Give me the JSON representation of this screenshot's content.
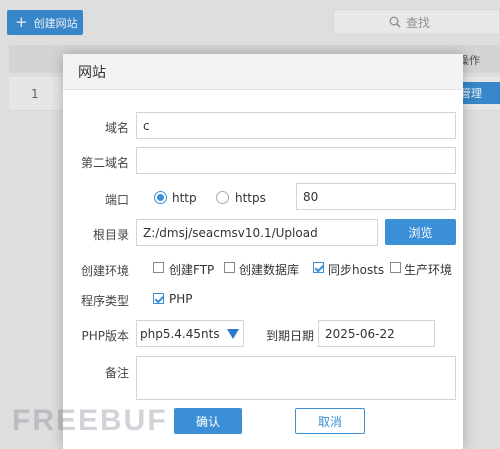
{
  "toolbar": {
    "create_label": "创建网站",
    "search_placeholder": "查找"
  },
  "table": {
    "ops_header": "操作",
    "rows": [
      {
        "num": "1",
        "manage_label": "管理"
      }
    ]
  },
  "modal": {
    "title": "网站",
    "domain": {
      "label": "域名",
      "value": "c"
    },
    "second_domain": {
      "label": "第二域名",
      "value": ""
    },
    "port": {
      "label": "端口",
      "http": "http",
      "https": "https",
      "value": "80",
      "selected": "http"
    },
    "root": {
      "label": "根目录",
      "value": "Z:/dmsj/seacmsv10.1/Upload",
      "browse": "浏览"
    },
    "env": {
      "label": "创建环境",
      "options": [
        {
          "text": "创建FTP",
          "checked": false
        },
        {
          "text": "创建数据库",
          "checked": false
        },
        {
          "text": "同步hosts",
          "checked": true
        },
        {
          "text": "生产环境",
          "checked": false
        }
      ]
    },
    "program": {
      "label": "程序类型",
      "php": "PHP",
      "checked": true
    },
    "php_version": {
      "label": "PHP版本",
      "value": "php5.4.45nts"
    },
    "expire": {
      "label": "到期日期",
      "value": "2025-06-22"
    },
    "remark": {
      "label": "备注",
      "value": ""
    },
    "confirm": "确认",
    "cancel": "取消"
  },
  "watermark": "FREEBUF",
  "colors": {
    "accent": "#3a8fd6"
  }
}
